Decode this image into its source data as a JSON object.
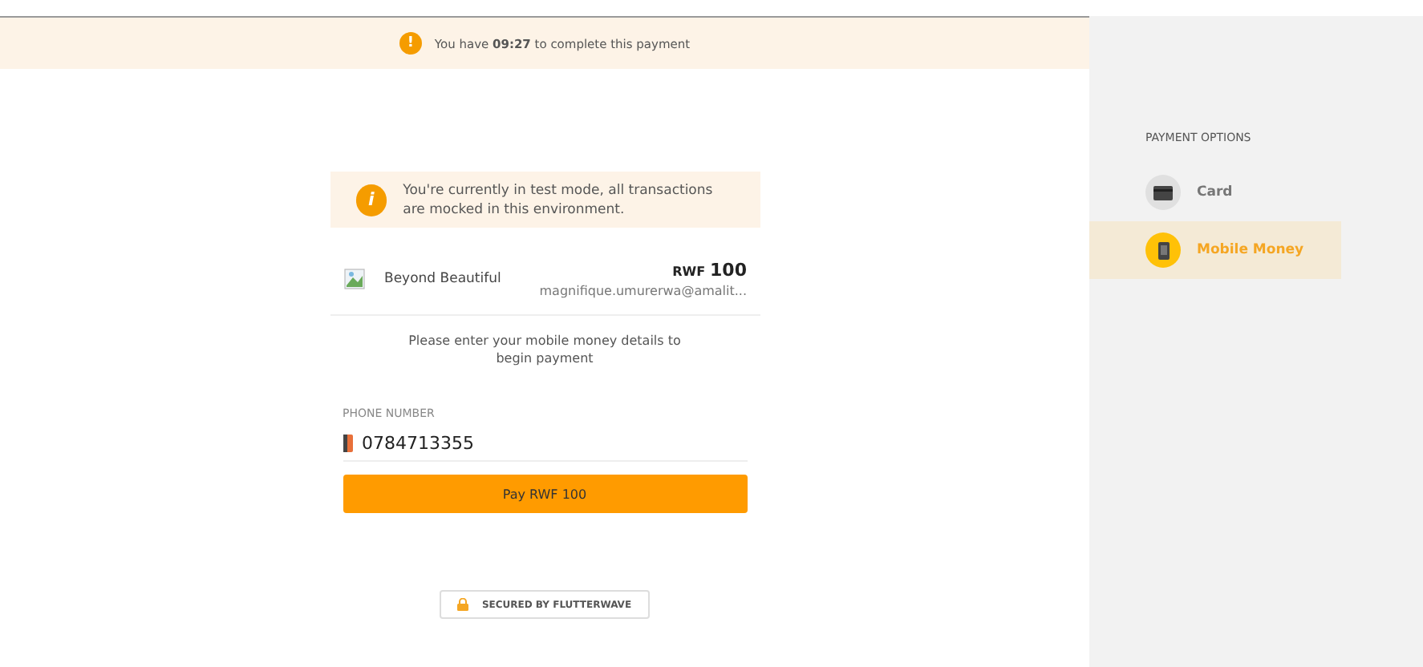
{
  "timer_banner": {
    "icon": "!",
    "text": "You have **09:27** to complete this payment"
  },
  "test_notice": {
    "icon": "i",
    "text": "You're currently in test mode, all transactions are mocked in this environment."
  },
  "merchant": {
    "name": "Beyond Beautiful",
    "currency": "RWF",
    "amount": "100",
    "email": "magnifique.umurerwa@amalit..."
  },
  "instruction": "Please enter your mobile money details to begin payment",
  "phone_field": {
    "label": "PHONE NUMBER",
    "value": "0784713355"
  },
  "pay_button": "Pay RWF 100",
  "secured_badge": "SECURED BY FLUTTERWAVE",
  "sidebar": {
    "heading": "PAYMENT OPTIONS",
    "items": [
      {
        "label": "Card",
        "kind": "card",
        "selected": false
      },
      {
        "label": "Mobile Money",
        "kind": "mobile",
        "selected": true
      }
    ]
  }
}
